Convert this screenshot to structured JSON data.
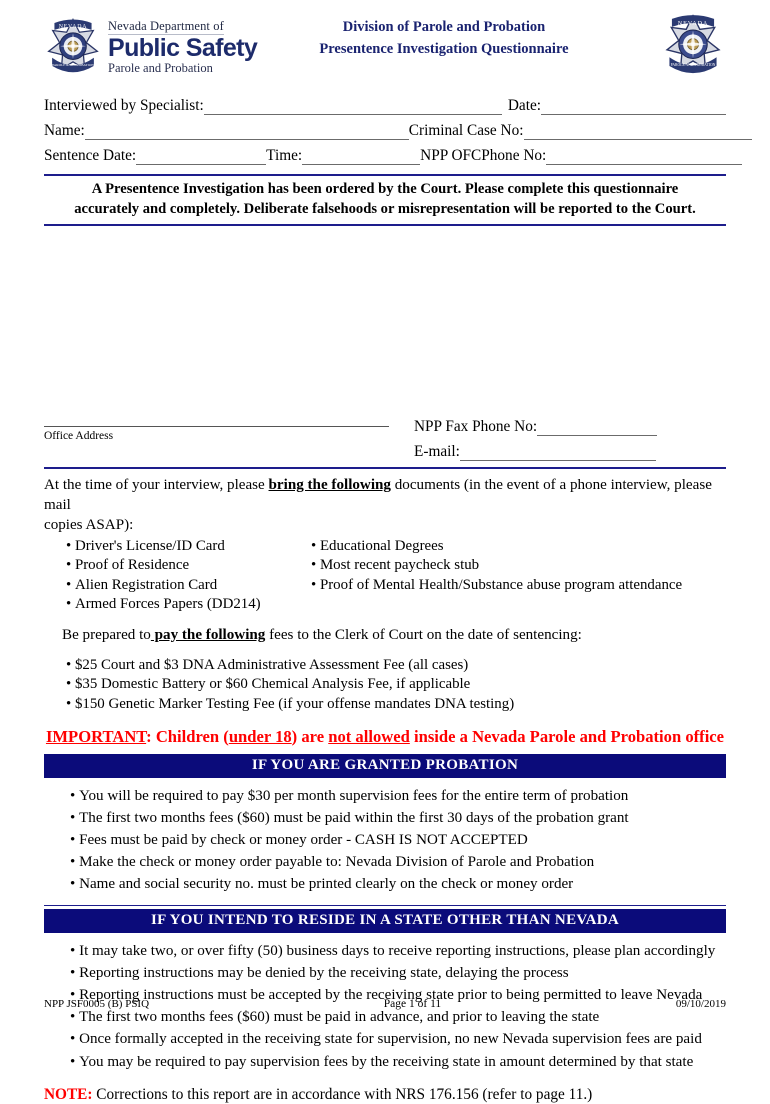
{
  "header": {
    "logo": {
      "dept_top": "Nevada Department of",
      "dept_main": "Public Safety",
      "dept_sub": "Parole and Probation",
      "badge_left_name": "nevada-dps-badge",
      "badge_right_name": "nevada-parole-probation-badge",
      "badge_text_top": "NEVADA",
      "badge_text_bottom": "PAROLE AND PROBATION"
    },
    "title_line1": "Division of Parole and Probation",
    "title_line2": "Presentence Investigation Questionnaire",
    "title_color": "#1a2370"
  },
  "form_fields": {
    "interviewed_by_label": "Interviewed by Specialist:",
    "interviewed_by_value": "",
    "date_label": "Date:",
    "date_value": "",
    "name_label": "Name:",
    "name_value": "",
    "criminal_case_label": "Criminal Case No:",
    "criminal_case_value": "",
    "sentence_date_label": "Sentence Date:",
    "sentence_date_value": "",
    "time_label": "Time:",
    "time_value": "",
    "npp_ofc_phone_label": "NPP OFCPhone No:",
    "npp_ofc_phone_value": ""
  },
  "notice": {
    "line1": "A Presentence Investigation has been ordered by the Court.  Please complete this questionnaire",
    "line2": "accurately and completely.  Deliberate falsehoods or misrepresentation will be reported to the Court."
  },
  "office": {
    "address_value": "",
    "address_caption": "Office Address",
    "fax_label": "NPP Fax Phone No:",
    "fax_value": "",
    "email_label": "E-mail:",
    "email_value": ""
  },
  "bring": {
    "intro_pre": "At the time of your interview, please ",
    "intro_emph": "bring the following",
    "intro_post": " documents (in the event of a phone interview, please mail",
    "intro_line2": "copies ASAP):",
    "column_left": [
      "Driver's License/ID Card",
      "Proof of Residence",
      "Alien Registration Card",
      "Armed Forces Papers (DD214)"
    ],
    "column_right": [
      "Educational Degrees",
      "Most recent paycheck stub",
      "Proof of Mental Health/Substance abuse program attendance"
    ]
  },
  "fees": {
    "intro_pre": "Be prepared to",
    "intro_emph": " pay the following",
    "intro_post": " fees to the Clerk of Court on the date of sentencing:",
    "items": [
      "$25 Court and $3 DNA Administrative Assessment Fee (all cases)",
      "$35 Domestic Battery  or $60 Chemical Analysis Fee, if applicable",
      "$150 Genetic Marker Testing Fee (if your offense mandates DNA testing)"
    ]
  },
  "important": {
    "word": "IMPORTANT",
    "seg1": ": Children (",
    "underline1": "under 18",
    "seg2": ") are ",
    "underline2": "not allowed",
    "seg3": " inside a Nevada Parole and Probation office",
    "color": "#FF0000"
  },
  "granted_probation": {
    "banner": "IF YOU ARE GRANTED PROBATION",
    "banner_bg": "#0b0b7a",
    "items": [
      "You will be required to pay $30 per month supervision fees for the entire term of probation",
      "The first two months fees ($60) must be paid within the first 30 days of the probation grant",
      "Fees must be paid by check or money order - CASH IS NOT ACCEPTED",
      "Make the check or money order payable to: Nevada Division of Parole and Probation",
      "Name and social security no. must be printed clearly on the check or money order"
    ]
  },
  "other_state": {
    "banner": "IF YOU INTEND TO RESIDE IN A STATE OTHER THAN NEVADA",
    "banner_bg": "#0b0b7a",
    "items": [
      "It may take two, or over fifty (50) business days to receive reporting instructions, please plan accordingly",
      "Reporting instructions may be denied by the receiving state, delaying the process",
      "Reporting instructions must be accepted by the receiving state prior to being permitted to leave Nevada",
      "The first two months fees ($60) must be paid in advance, and prior to leaving the state",
      "Once formally accepted in the receiving state for supervision, no new Nevada supervision fees are paid",
      "You may be required to pay supervision fees by the receiving state in amount determined by that state"
    ]
  },
  "note": {
    "label": "NOTE:",
    "text": " Corrections to this report are in accordance with NRS 176.156 (refer to page 11.)"
  },
  "footer": {
    "form_id": "NPP JSF0005 (B) PSIQ",
    "page": "Page 1 of 11",
    "date": "09/10/2019"
  }
}
